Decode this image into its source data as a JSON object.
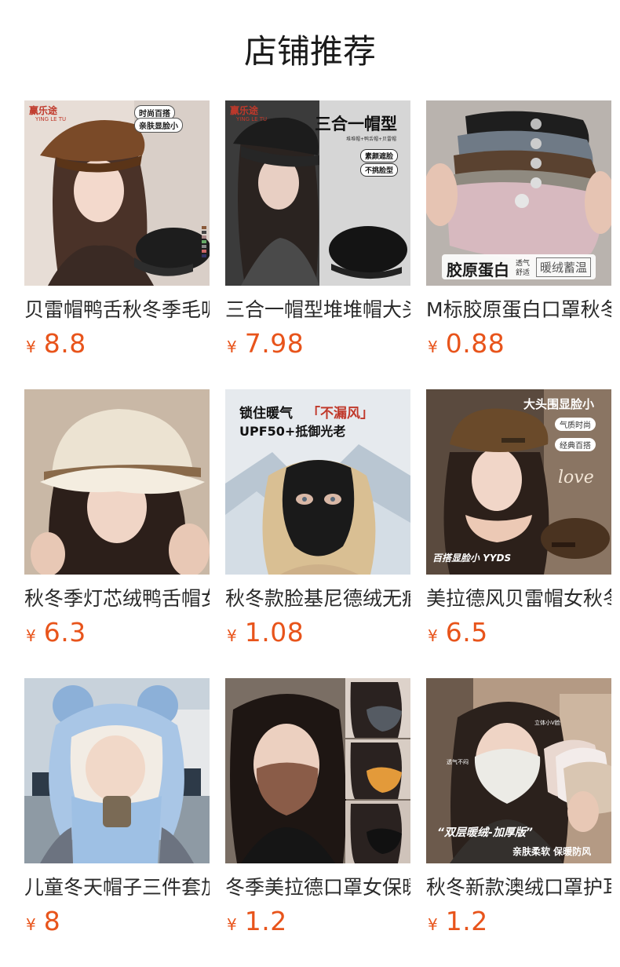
{
  "header": {
    "title": "店铺推荐"
  },
  "currency_symbol": "¥",
  "products": [
    {
      "name": "贝雷帽鸭舌秋冬季毛呢",
      "price": "8.8",
      "image": {
        "brand": "赢乐途",
        "brand_sub": "YING LE TU",
        "tags": [
          "时尚百搭",
          "亲肤显脸小"
        ]
      }
    },
    {
      "name": "三合一帽型堆堆帽大头",
      "price": "7.98",
      "image": {
        "brand": "赢乐途",
        "brand_sub": "YING LE TU",
        "headline": "三合一帽型",
        "subline": "堆堆帽+鸭舌帽+贝雷帽",
        "tags": [
          "素颜遮脸",
          "不挑脸型"
        ]
      }
    },
    {
      "name": "M标胶原蛋白口罩秋冬",
      "price": "0.88",
      "image": {
        "headline": "胶原蛋白",
        "sub1": "透气",
        "sub2": "舒适",
        "tag": "暖绒蓄温"
      }
    },
    {
      "name": "秋冬季灯芯绒鸭舌帽女",
      "price": "6.3",
      "image": {}
    },
    {
      "name": "秋冬款脸基尼德绒无痕",
      "price": "1.08",
      "image": {
        "line1_a": "锁住暖气",
        "line1_b": "「不漏风」",
        "line2": "UPF50+抵御光老"
      }
    },
    {
      "name": "美拉德风贝雷帽女秋冬",
      "price": "6.5",
      "image": {
        "headline": "大头围显脸小",
        "tags": [
          "气质时尚",
          "经典百搭"
        ],
        "script": "love",
        "caption": "百搭显脸小 YYDS"
      }
    },
    {
      "name": "儿童冬天帽子三件套加",
      "price": "8",
      "image": {}
    },
    {
      "name": "冬季美拉德口罩女保暖",
      "price": "1.2",
      "image": {}
    },
    {
      "name": "秋冬新款澳绒口罩护耳",
      "price": "1.2",
      "image": {
        "tag1": "立体小V脸",
        "tag2": "透气不闷",
        "banner": "“双层暖绒-加厚版”",
        "caption": "亲肤柔软 保暖防风"
      }
    }
  ],
  "colors": {
    "price": "#e8541b",
    "title": "#1a1a1a",
    "name": "#2a2a2a"
  }
}
